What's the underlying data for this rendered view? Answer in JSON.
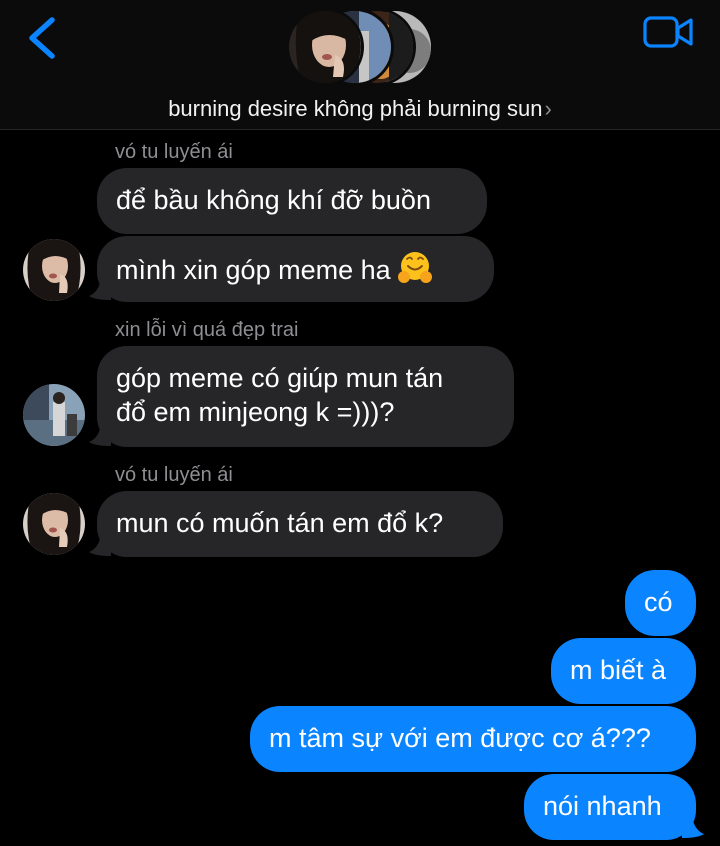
{
  "header": {
    "group_name": "burning desire không phải burning sun",
    "chevron": "›",
    "back_icon": "chevron-left-icon",
    "video_icon": "video-camera-icon",
    "accent_color": "#0a84ff"
  },
  "messages": [
    {
      "sender": "vó tu luyến ái",
      "text": "để bầu không khí đỡ buồn",
      "direction": "incoming"
    },
    {
      "text": "mình xin góp meme ha",
      "emoji": "hugging-face-emoji",
      "direction": "incoming"
    },
    {
      "sender": "xin lỗi vì quá đẹp trai",
      "lines": [
        "góp meme có giúp mun tán",
        "đổ em minjeong k =)))?"
      ],
      "direction": "incoming"
    },
    {
      "sender": "vó tu luyến ái",
      "text": "mun có muốn tán em đổ k?",
      "direction": "incoming"
    },
    {
      "text": "có",
      "direction": "outgoing"
    },
    {
      "text": "m biết à",
      "direction": "outgoing"
    },
    {
      "text": "m tâm sự với em được cơ á???",
      "direction": "outgoing"
    },
    {
      "text": "nói nhanh",
      "direction": "outgoing"
    }
  ],
  "colors": {
    "incoming_bubble": "#262628",
    "outgoing_bubble": "#0a84ff",
    "sender_label": "#8e8e93",
    "background": "#000000"
  }
}
